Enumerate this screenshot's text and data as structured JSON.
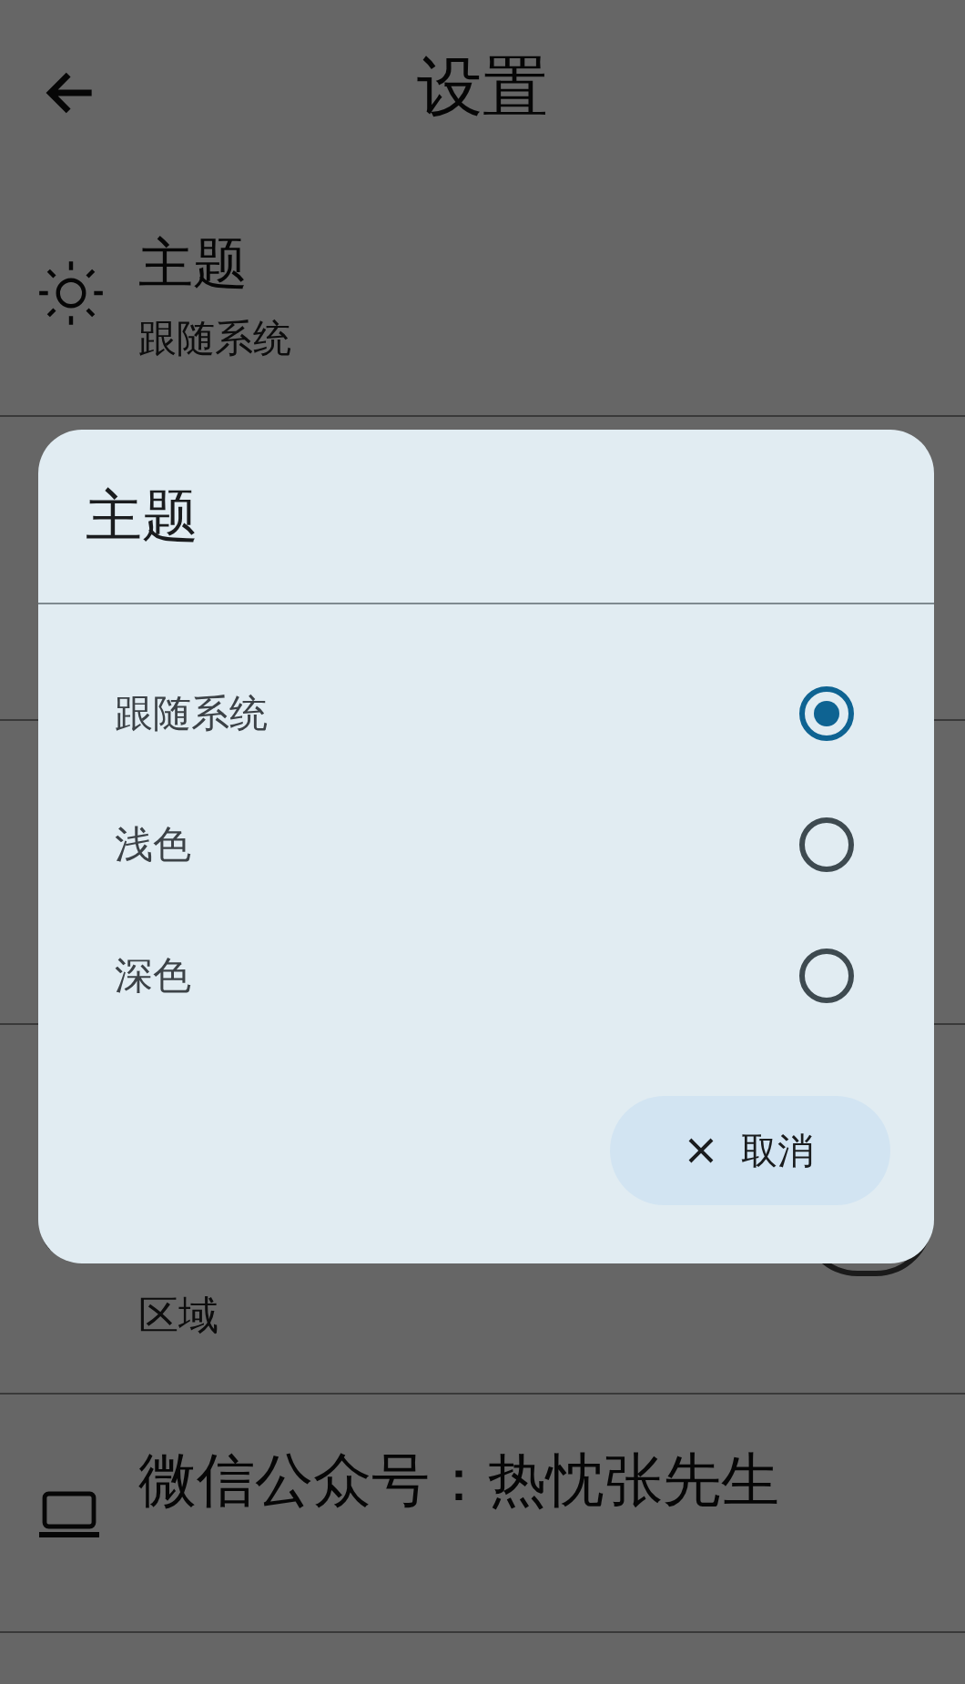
{
  "header": {
    "title": "设置"
  },
  "settings": [
    {
      "kind": "theme",
      "title": "主题",
      "value": "跟随系统"
    },
    {
      "kind": "hidden"
    },
    {
      "kind": "hidden"
    },
    {
      "kind": "toggle",
      "description": "区域",
      "on": false
    },
    {
      "kind": "link",
      "title": "微信公众号：热忱张先生"
    }
  ],
  "dialog": {
    "title": "主题",
    "options": [
      {
        "label": "跟随系统",
        "selected": true
      },
      {
        "label": "浅色",
        "selected": false
      },
      {
        "label": "深色",
        "selected": false
      }
    ],
    "cancel": "取消"
  }
}
